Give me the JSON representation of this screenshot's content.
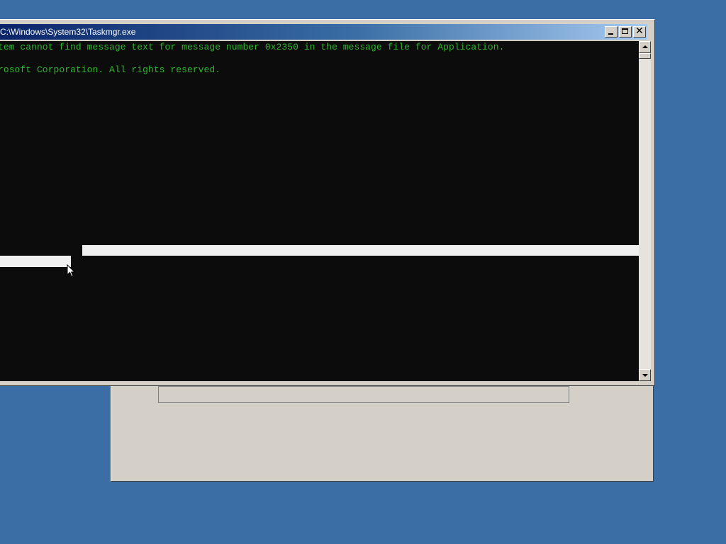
{
  "console_window": {
    "title": "C:\\Windows\\System32\\Taskmgr.exe",
    "lines": [
      "tem cannot find message text for message number 0x2350 in the message file for Application.",
      "rosoft Corporation. All rights reserved."
    ],
    "text_color": "#2db82d",
    "background_color": "#0c0c0c"
  },
  "title_bar": {
    "minimize_icon": "minimize-icon",
    "maximize_icon": "maximize-icon",
    "close_icon": "close-icon"
  },
  "scrollbar": {
    "up_icon": "scroll-up-arrow-icon",
    "down_icon": "scroll-down-arrow-icon"
  },
  "colors": {
    "desktop": "#3a6ea5",
    "dialog_face": "#d4d0c8"
  }
}
